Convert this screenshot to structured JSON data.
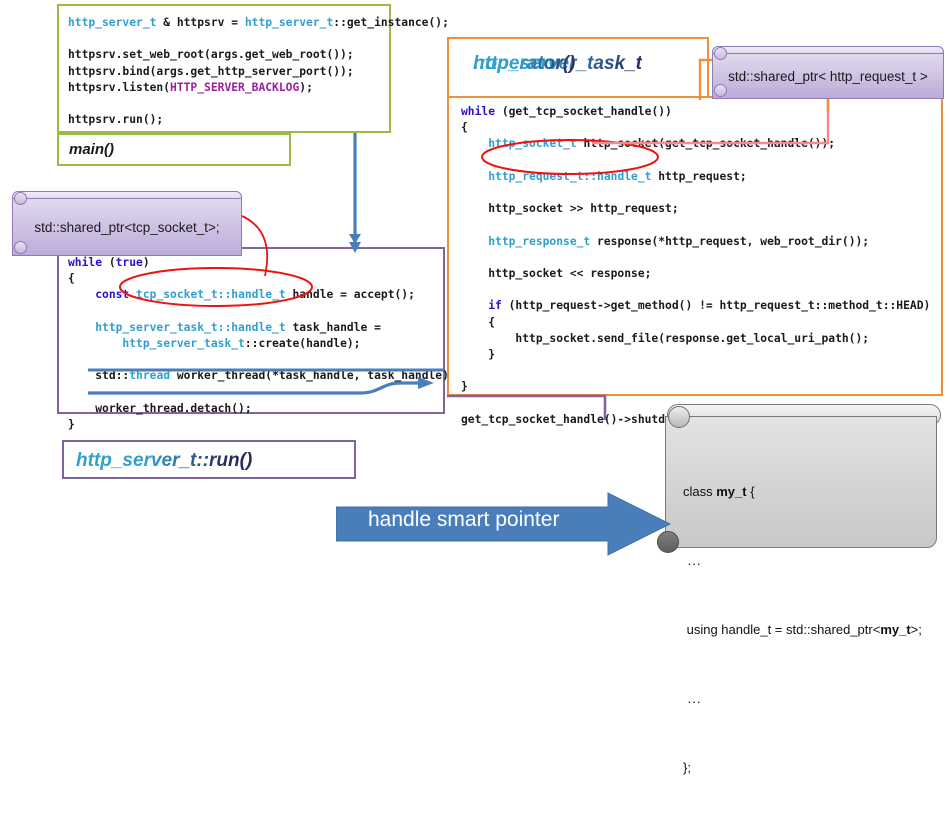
{
  "diagram": {
    "title": "handle smart pointer",
    "colors": {
      "green_border": "#9bbb49",
      "purple_border": "#8064a2",
      "orange_border": "#f08e3a",
      "blue_arrow": "#4a7ebb",
      "red_ellipse": "#ee1111",
      "type_blue": "#2f9fd0",
      "keyword_blue": "#2b10c8",
      "macro_purple": "#9b1f9b",
      "note_purple": "#bcabd8",
      "note_gray": "#d2d2d2"
    }
  },
  "green_block": {
    "label": "main()",
    "lines": [
      [
        {
          "t": "http_server_t",
          "c": "ty"
        },
        {
          "t": " & httpsrv = ",
          "c": ""
        },
        {
          "t": "http_server_t",
          "c": "ty"
        },
        {
          "t": "::get_instance();",
          "c": ""
        }
      ],
      [
        {
          "t": "",
          "c": ""
        }
      ],
      [
        {
          "t": "httpsrv.set_web_root(args.get_web_root());",
          "c": ""
        }
      ],
      [
        {
          "t": "httpsrv.bind(args.get_http_server_port());",
          "c": ""
        }
      ],
      [
        {
          "t": "httpsrv.listen(",
          "c": ""
        },
        {
          "t": "HTTP_SERVER_BACKLOG",
          "c": "mac"
        },
        {
          "t": ");",
          "c": ""
        }
      ],
      [
        {
          "t": "",
          "c": ""
        }
      ],
      [
        {
          "t": "httpsrv.run();",
          "c": ""
        }
      ]
    ]
  },
  "purple_block": {
    "label": "http_server_t::run()",
    "lines": [
      [
        {
          "t": "while",
          "c": "kw"
        },
        {
          "t": " (",
          "c": ""
        },
        {
          "t": "true",
          "c": "kw"
        },
        {
          "t": ")",
          "c": ""
        }
      ],
      [
        {
          "t": "{",
          "c": ""
        }
      ],
      [
        {
          "t": "    ",
          "c": ""
        },
        {
          "t": "const",
          "c": "kw"
        },
        {
          "t": " ",
          "c": ""
        },
        {
          "t": "tcp_socket_t::handle_t",
          "c": "ty"
        },
        {
          "t": " handle = accept();",
          "c": ""
        }
      ],
      [
        {
          "t": "",
          "c": ""
        }
      ],
      [
        {
          "t": "    ",
          "c": ""
        },
        {
          "t": "http_server_task_t::handle_t",
          "c": "ty"
        },
        {
          "t": " task_handle =",
          "c": ""
        }
      ],
      [
        {
          "t": "        ",
          "c": ""
        },
        {
          "t": "http_server_task_t",
          "c": "ty"
        },
        {
          "t": "::create(handle);",
          "c": ""
        }
      ],
      [
        {
          "t": "",
          "c": ""
        }
      ],
      [
        {
          "t": "    ",
          "c": ""
        },
        {
          "t": "std::",
          "c": ""
        },
        {
          "t": "thread",
          "c": "ty"
        },
        {
          "t": " worker_thread(*task_handle, task_handle);",
          "c": ""
        }
      ],
      [
        {
          "t": "",
          "c": ""
        }
      ],
      [
        {
          "t": "    worker_thread.detach();",
          "c": ""
        }
      ],
      [
        {
          "t": "}",
          "c": ""
        }
      ]
    ]
  },
  "orange_block": {
    "title_line1": "http_server_task_t",
    "title_line2": "::operator()",
    "lines": [
      [
        {
          "t": "while",
          "c": "kw"
        },
        {
          "t": " (get_tcp_socket_handle())",
          "c": ""
        }
      ],
      [
        {
          "t": "{",
          "c": ""
        }
      ],
      [
        {
          "t": "    ",
          "c": ""
        },
        {
          "t": "http_socket_t",
          "c": "ty"
        },
        {
          "t": " http_socket(get_tcp_socket_handle());",
          "c": ""
        }
      ],
      [
        {
          "t": "",
          "c": ""
        }
      ],
      [
        {
          "t": "    ",
          "c": ""
        },
        {
          "t": "http_request_t::handle_t",
          "c": "ty"
        },
        {
          "t": " http_request;",
          "c": ""
        }
      ],
      [
        {
          "t": "",
          "c": ""
        }
      ],
      [
        {
          "t": "    http_socket >> http_request;",
          "c": ""
        }
      ],
      [
        {
          "t": "",
          "c": ""
        }
      ],
      [
        {
          "t": "    ",
          "c": ""
        },
        {
          "t": "http_response_t",
          "c": "ty"
        },
        {
          "t": " response(*http_request, web_root_dir());",
          "c": ""
        }
      ],
      [
        {
          "t": "",
          "c": ""
        }
      ],
      [
        {
          "t": "    http_socket << response;",
          "c": ""
        }
      ],
      [
        {
          "t": "",
          "c": ""
        }
      ],
      [
        {
          "t": "    ",
          "c": ""
        },
        {
          "t": "if",
          "c": "kw"
        },
        {
          "t": " (http_request->get_method() != http_request_t::method_t::HEAD)",
          "c": ""
        }
      ],
      [
        {
          "t": "    {",
          "c": ""
        }
      ],
      [
        {
          "t": "        http_socket.send_file(response.get_local_uri_path();",
          "c": ""
        }
      ],
      [
        {
          "t": "    }",
          "c": ""
        }
      ],
      [
        {
          "t": "",
          "c": ""
        }
      ],
      [
        {
          "t": "}",
          "c": ""
        }
      ],
      [
        {
          "t": "",
          "c": ""
        }
      ],
      [
        {
          "t": "get_tcp_socket_handle()->shutdown();",
          "c": ""
        }
      ]
    ]
  },
  "notes": {
    "tcp_socket": "std::shared_ptr<tcp_socket_t>;",
    "http_request": "std::shared_ptr< http_request_t >"
  },
  "gray_note": {
    "line1_pre": "class ",
    "line1_bold": "my_t",
    "line1_post": " {",
    "line2": "...",
    "line3_pre": " using handle_t = std::shared_ptr<",
    "line3_bold": "my_t",
    "line3_post": ">;",
    "line4": "...",
    "line5": "};"
  }
}
